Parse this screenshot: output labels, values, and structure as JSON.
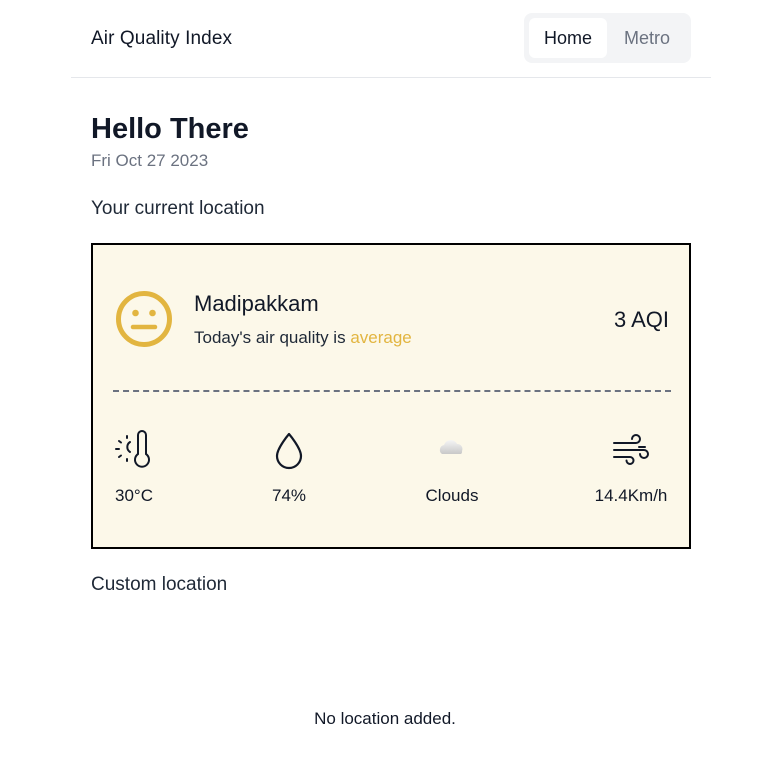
{
  "header": {
    "app_title": "Air Quality Index",
    "nav": [
      {
        "label": "Home",
        "active": true
      },
      {
        "label": "Metro",
        "active": false
      }
    ]
  },
  "greeting": {
    "title": "Hello There",
    "date": "Fri Oct 27 2023"
  },
  "current": {
    "section_title": "Your current location",
    "location": "Madipakkam",
    "quality_prefix": "Today's air quality is ",
    "quality_status": "average",
    "aqi": "3 AQI",
    "face_icon": "neutral-face-icon",
    "colors": {
      "card_bg": "#fcf8e9",
      "status": "#e2b540",
      "border": "#000000"
    },
    "stats": [
      {
        "icon": "thermometer-sun-icon",
        "value": "30°C"
      },
      {
        "icon": "droplet-icon",
        "value": "74%"
      },
      {
        "icon": "cloud-icon",
        "value": "Clouds"
      },
      {
        "icon": "wind-icon",
        "value": "14.4Km/h"
      }
    ]
  },
  "custom": {
    "section_title": "Custom location",
    "empty_text": "No location added."
  }
}
